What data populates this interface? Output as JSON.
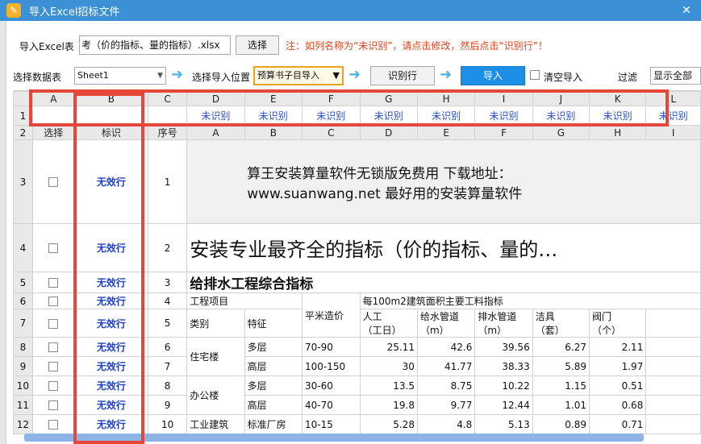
{
  "window": {
    "title": "导入Excel招标文件",
    "close_glyph": "✕",
    "icon_glyph": "✎"
  },
  "import_bar": {
    "file_label": "导入Excel表",
    "file_value": "考（价的指标、量的指标）.xlsx",
    "browse_label": "选择",
    "hint": "注：如列名称为“未识别”，请点击修改，然后点击“识别行”！"
  },
  "toolbar": {
    "sheet_label": "选择数据表",
    "sheet_value": "Sheet1",
    "pos_label": "选择导入位置",
    "pos_value": "预算书子目导入",
    "identify_label": "识别行",
    "import_label": "导入",
    "clear_label": "清空导入",
    "filter_label": "过滤",
    "filter_value": "显示全部"
  },
  "grid": {
    "col_letters": [
      "A",
      "B",
      "C",
      "D",
      "E",
      "F",
      "G",
      "H",
      "I",
      "J",
      "K",
      "L"
    ],
    "row1_num": "1",
    "unrecognized": "未识别",
    "row2": {
      "num": "2",
      "select": "选择",
      "mark": "标识",
      "seq": "序号",
      "cols": [
        "A",
        "B",
        "C",
        "D",
        "E",
        "F",
        "G",
        "H",
        "I"
      ]
    },
    "invalid_label": "无效行",
    "rows": [
      {
        "num": "3",
        "seq": "1",
        "text1": "算王安装算量软件无锁版免费用  下载地址：",
        "text2": "www.suanwang.net   最好用的安装算量软件"
      },
      {
        "num": "4",
        "seq": "2",
        "text": "安装专业最齐全的指标（价的指标、量的…"
      },
      {
        "num": "5",
        "seq": "3",
        "text": "给排水工程综合指标"
      },
      {
        "num": "6",
        "seq": "4",
        "a": "工程项目",
        "c": "平米造价",
        "d": "每100m2建筑面积主要工料指标"
      },
      {
        "num": "7",
        "seq": "5",
        "a": "类别",
        "b": "特征",
        "d1": "人工",
        "d2": "（工日）",
        "e1": "给水管道",
        "e2": "（m）",
        "f1": "排水管道",
        "f2": "（m）",
        "g1": "洁具",
        "g2": "（套）",
        "h1": "阀门",
        "h2": "（个）"
      },
      {
        "num": "8",
        "seq": "6",
        "a": "住宅楼",
        "b": "多层",
        "c": "70-90",
        "d": "25.11",
        "e": "42.6",
        "f": "39.56",
        "g": "6.27",
        "h": "2.11"
      },
      {
        "num": "9",
        "seq": "7",
        "b": "高层",
        "c": "100-150",
        "d": "30",
        "e": "41.77",
        "f": "38.33",
        "g": "5.89",
        "h": "1.97"
      },
      {
        "num": "10",
        "seq": "8",
        "a": "办公楼",
        "b": "多层",
        "c": "30-60",
        "d": "13.5",
        "e": "8.75",
        "f": "10.22",
        "g": "1.15",
        "h": "0.51"
      },
      {
        "num": "11",
        "seq": "9",
        "b": "高层",
        "c": "40-70",
        "d": "19.8",
        "e": "9.77",
        "f": "12.44",
        "g": "1.01",
        "h": "0.68"
      },
      {
        "num": "12",
        "seq": "10",
        "a": "工业建筑",
        "b": "标准厂房",
        "c": "10-15",
        "d": "5.28",
        "e": "4.8",
        "f": "5.13",
        "g": "0.89",
        "h": "0.71"
      }
    ]
  },
  "colors": {
    "title_bar": "#3c90d6",
    "highlight_box": "#e5483b",
    "invalid_text": "#1d3ec8",
    "hint_text": "#e0421a"
  }
}
